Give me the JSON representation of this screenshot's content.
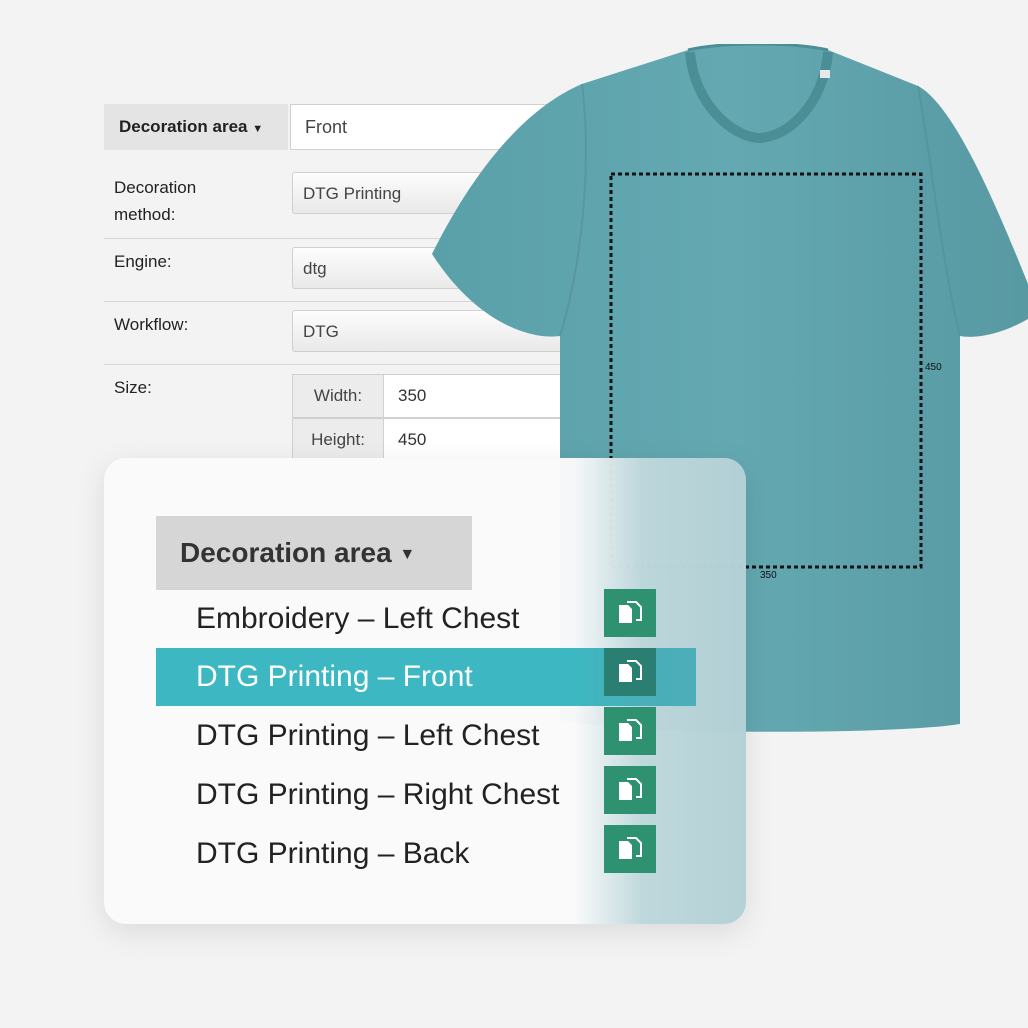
{
  "form": {
    "decoration_area_label": "Decoration area",
    "decoration_area_value": "Front",
    "decoration_method_label_line1": "Decoration",
    "decoration_method_label_line2": "method:",
    "decoration_method_value": "DTG Printing",
    "engine_label": "Engine:",
    "engine_value": "dtg",
    "workflow_label": "Workflow:",
    "workflow_value": "DTG",
    "size_label": "Size:",
    "width_label": "Width:",
    "width_value": "350",
    "height_label": "Height:",
    "height_value": "450"
  },
  "print_area": {
    "width_text": "350",
    "height_text": "450"
  },
  "dropdown": {
    "title": "Decoration area",
    "items": [
      {
        "label": "Embroidery – Left Chest",
        "selected": false
      },
      {
        "label": "DTG Printing – Front",
        "selected": true
      },
      {
        "label": "DTG Printing – Left Chest",
        "selected": false
      },
      {
        "label": "DTG Printing – Right Chest",
        "selected": false
      },
      {
        "label": "DTG Printing – Back",
        "selected": false
      }
    ]
  },
  "colors": {
    "accent_selected": "#3db8c2",
    "copy_button": "#2e9170",
    "tshirt": "#5fa3ac"
  },
  "icons": {
    "dropdown_caret": "caret-down-icon",
    "copy": "copy-icon"
  }
}
